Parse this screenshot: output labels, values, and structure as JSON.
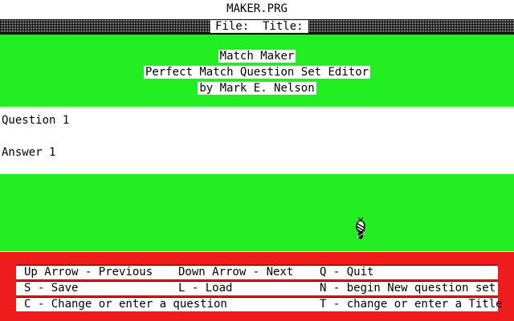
{
  "window": {
    "title": "MAKER.PRG",
    "file_bar": "File:  Title:"
  },
  "header": {
    "app_name": "Match Maker",
    "subtitle": "Perfect Match Question Set Editor",
    "author": "by Mark E. Nelson"
  },
  "content": {
    "question_label": "Question 1",
    "answer_label": "Answer 1"
  },
  "help": {
    "rows": [
      [
        "Up Arrow - Previous",
        "Down Arrow - Next",
        "Q - Quit"
      ],
      [
        "S - Save",
        "L - Load",
        "N - begin New question set"
      ],
      [
        "C - Change or enter a question",
        "",
        "T - change or enter a Title"
      ]
    ]
  },
  "colors": {
    "green": "#22ee22",
    "red": "#ee1c1c",
    "white": "#ffffff"
  },
  "icons": {
    "pointer": "busy-bee-cursor-icon"
  }
}
